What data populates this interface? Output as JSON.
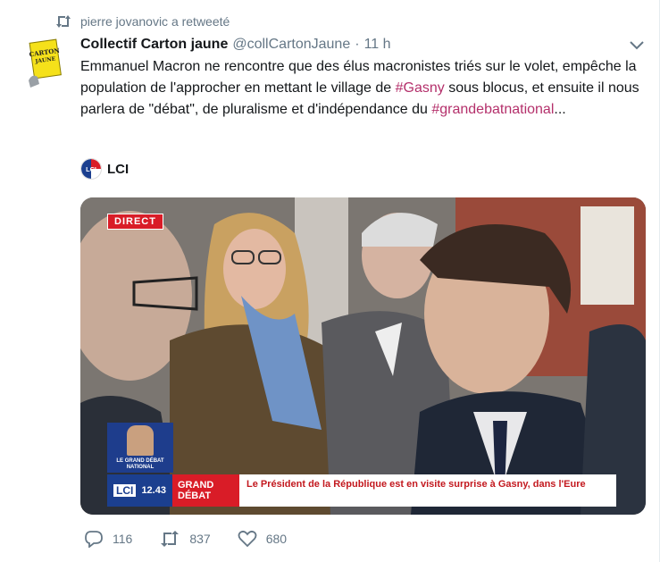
{
  "retweet_context": {
    "icon": "retweet-icon",
    "text": "pierre jovanovic a retweeté"
  },
  "tweet": {
    "author_name": "Collectif Carton jaune",
    "author_handle": "@collCartonJaune",
    "separator": "·",
    "time": "11 h",
    "avatar_text": [
      "CARTON",
      "JAUNE"
    ],
    "text_parts": {
      "p1": "Emmanuel Macron ne rencontre que des élus macronistes triés sur le volet, empêche la population de l'approcher en mettant le village de ",
      "hashtag1": "#Gasny",
      "p2": " sous blocus, et ensuite il nous parlera de \"débat\", de pluralisme et d'indépendance du ",
      "hashtag2": "#grandebatnational",
      "p3": "..."
    },
    "link_color": "#b4306b"
  },
  "source": {
    "logo_text": "LCI",
    "name": "LCI"
  },
  "video": {
    "live_badge": "DIRECT",
    "thumb_text": "LE GRAND DÉBAT NATIONAL",
    "channel": "LCI",
    "clock": "12.43",
    "show": "GRAND DÉBAT",
    "headline": "Le Président de la République est en visite surprise à Gasny, dans l'Eure"
  },
  "actions": {
    "replies": "116",
    "retweets": "837",
    "likes": "680"
  },
  "colors": {
    "muted": "#657786",
    "text": "#14171a",
    "lci_blue": "#1b3f8f",
    "tv_red": "#d91c27"
  }
}
